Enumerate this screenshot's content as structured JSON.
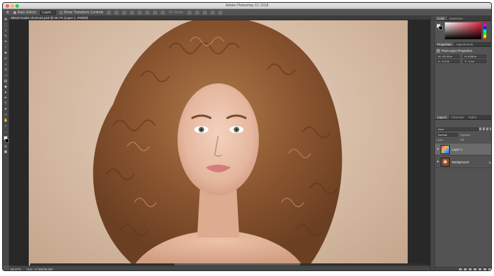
{
  "app": {
    "title": "Adobe Photoshop CC 2018"
  },
  "options_bar": {
    "auto_select_label": "Auto-Select:",
    "auto_select_value": "Layer",
    "show_transform_label": "Show Transform Controls",
    "mode_3d_label": "3D Mode:"
  },
  "document": {
    "tab_label": "Blend modes shortcuts.psd @ 66.7% (Layer 1, RGB/8)",
    "zoom": "66.67%",
    "doc_info": "Doc: 17.5M/35.0M"
  },
  "tools": [
    "move-tool",
    "marquee-tool",
    "lasso-tool",
    "quick-select-tool",
    "crop-tool",
    "eyedropper-tool",
    "healing-tool",
    "brush-tool",
    "clone-stamp-tool",
    "history-brush-tool",
    "eraser-tool",
    "gradient-tool",
    "blur-tool",
    "dodge-tool",
    "pen-tool",
    "type-tool",
    "path-select-tool",
    "rectangle-tool",
    "hand-tool",
    "zoom-tool",
    "more-tools",
    "default-colors",
    "quick-mask",
    "screen-mode"
  ],
  "color_panel": {
    "tabs": [
      "Color",
      "Swatches"
    ],
    "foreground": "#ffffff",
    "background": "#000000",
    "picker_hue": "#e8243c"
  },
  "properties_panel": {
    "tabs": [
      "Properties",
      "Adjustments"
    ],
    "header": "Pixel Layer Properties",
    "w_label": "W:",
    "w_value": "13.29 in",
    "h_label": "H:",
    "h_value": "8.86 in",
    "x_label": "X:",
    "x_value": "-0.2 in",
    "y_label": "Y:",
    "y_value": "-1 px"
  },
  "layers_panel": {
    "tabs": [
      "Layers",
      "Channels",
      "Paths"
    ],
    "kind_filter": "Kind",
    "blend_mode": "Normal",
    "opacity_label": "Opacity:",
    "lock_label": "Lock:",
    "fill_label": "Fill:",
    "layers": [
      {
        "name": "Layer 1",
        "visible": true,
        "selected": true,
        "italic": false
      },
      {
        "name": "Background",
        "visible": true,
        "selected": false,
        "italic": true,
        "locked": true
      }
    ]
  }
}
